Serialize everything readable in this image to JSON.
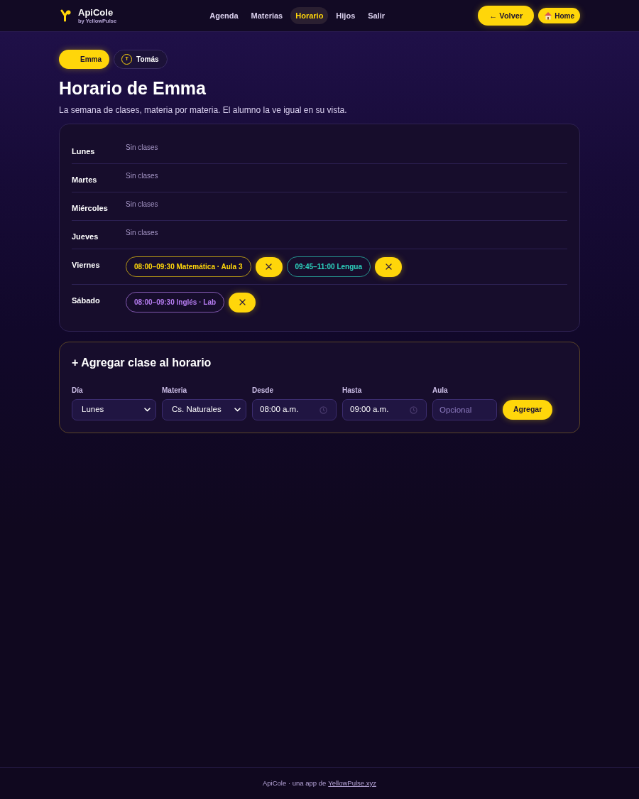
{
  "header": {
    "brand": {
      "name": "ApiCole",
      "tagline": "by YellowPulse"
    },
    "nav": [
      {
        "label": "Agenda",
        "selected": false
      },
      {
        "label": "Materias",
        "selected": false
      },
      {
        "label": "Horario",
        "selected": true
      },
      {
        "label": "Hijos",
        "selected": false
      },
      {
        "label": "Salir",
        "selected": false
      }
    ],
    "buttons": [
      {
        "label": "← Volver",
        "kind": "back"
      },
      {
        "label": "Home",
        "kind": "home"
      }
    ]
  },
  "kids": [
    {
      "name": "Emma",
      "selected": true
    },
    {
      "name": "Tomás",
      "initial": "T",
      "selected": false
    }
  ],
  "page": {
    "title": "Horario de Emma",
    "subtitle": "La semana de clases, materia por materia. El alumno la ve igual en su vista."
  },
  "schedule": {
    "days": [
      {
        "name": "Lunes",
        "note": "Sin clases"
      },
      {
        "name": "Martes",
        "note": "Sin clases"
      },
      {
        "name": "Miércoles",
        "note": "Sin clases"
      },
      {
        "name": "Jueves",
        "note": "Sin clases"
      },
      {
        "name": "Viernes",
        "classes": [
          {
            "text": "08:00–09:30 Matemática · Aula 3",
            "color": "#ffd60a"
          },
          {
            "text": "09:45–11:00 Lengua",
            "color": "#2dd4bf"
          }
        ]
      },
      {
        "name": "Sábado",
        "classes": [
          {
            "text": "08:00–09:30 Inglés · Lab",
            "color": "#b57cf0"
          }
        ]
      }
    ]
  },
  "add_form": {
    "title": "+ Agregar clase al horario",
    "fields": [
      {
        "label": "Día",
        "kind": "select",
        "value": "Lunes"
      },
      {
        "label": "Materia",
        "kind": "select",
        "value": "Cs. Naturales"
      },
      {
        "label": "Desde",
        "kind": "time",
        "value": "08:00 a.m."
      },
      {
        "label": "Hasta",
        "kind": "time",
        "value": "09:00 a.m."
      },
      {
        "label": "Aula",
        "kind": "text",
        "placeholder": "Opcional"
      }
    ],
    "submit": "Agregar"
  },
  "footer": {
    "text": "ApiCole · una app de",
    "link": "YellowPulse.xyz"
  }
}
